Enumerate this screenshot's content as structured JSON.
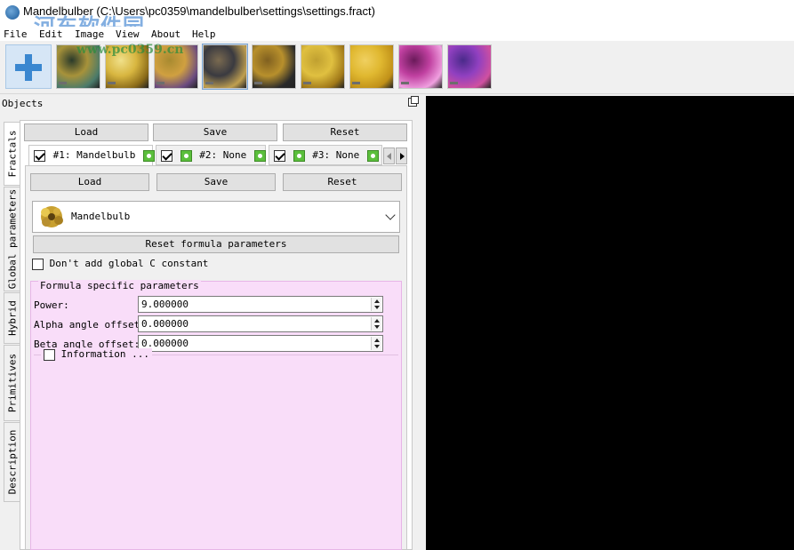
{
  "window": {
    "title": "Mandelbulber (C:\\Users\\pc0359\\mandelbulber\\settings\\settings.fract)",
    "watermark": "河东软件园",
    "watermark_url": "www.pc0359.cn"
  },
  "menu": [
    "File",
    "Edit",
    "Image",
    "View",
    "About",
    "Help"
  ],
  "toolbar": {
    "presets": [
      {
        "colors": [
          "#a7923a",
          "#4a7a6a",
          "#2a3a2a"
        ]
      },
      {
        "colors": [
          "#d8b640",
          "#8a6a18",
          "#f0e08a"
        ]
      },
      {
        "colors": [
          "#d0a040",
          "#6a4a80",
          "#a88a30"
        ]
      },
      {
        "colors": [
          "#3a3a40",
          "#c0a050",
          "#7a6a50"
        ]
      },
      {
        "colors": [
          "#b8902c",
          "#2a2a2a",
          "#806020"
        ]
      },
      {
        "colors": [
          "#e0c040",
          "#a07818",
          "#c0a030"
        ]
      },
      {
        "colors": [
          "#e0b830",
          "#c09018",
          "#f0d060"
        ]
      },
      {
        "colors": [
          "#c040a0",
          "#f0a0e0",
          "#6a1a5a"
        ]
      },
      {
        "colors": [
          "#9040c0",
          "#d050a0",
          "#4a2a8a"
        ]
      }
    ]
  },
  "dock": {
    "title": "Objects",
    "vertical_tabs": [
      "Fractals",
      "Global parameters",
      "Hybrid",
      "Primitives",
      "Description"
    ]
  },
  "top_buttons": {
    "load": "Load",
    "save": "Save",
    "reset": "Reset"
  },
  "fractal_tabs": [
    {
      "label": "#1: Mandelbulb",
      "checked": true
    },
    {
      "label": "#2: None",
      "checked": true
    },
    {
      "label": "#3: None",
      "checked": true
    }
  ],
  "inner_buttons": {
    "load": "Load",
    "save": "Save",
    "reset": "Reset"
  },
  "formula": {
    "selected": "Mandelbulb",
    "reset_button": "Reset formula parameters",
    "no_global_c_label": "Don't add global C constant",
    "no_global_c_checked": false
  },
  "formula_params": {
    "title": "Formula specific parameters",
    "rows": [
      {
        "label": "Power:",
        "value": "9.000000"
      },
      {
        "label": "Alpha angle offset:",
        "value": "0.000000"
      },
      {
        "label": "Beta angle offset:",
        "value": "0.000000"
      }
    ],
    "information_label": "Information ..."
  },
  "colors": {
    "params_bg": "#f9ddf9",
    "viewport_bg": "#000000",
    "go_icon": "#5bbf3c"
  }
}
